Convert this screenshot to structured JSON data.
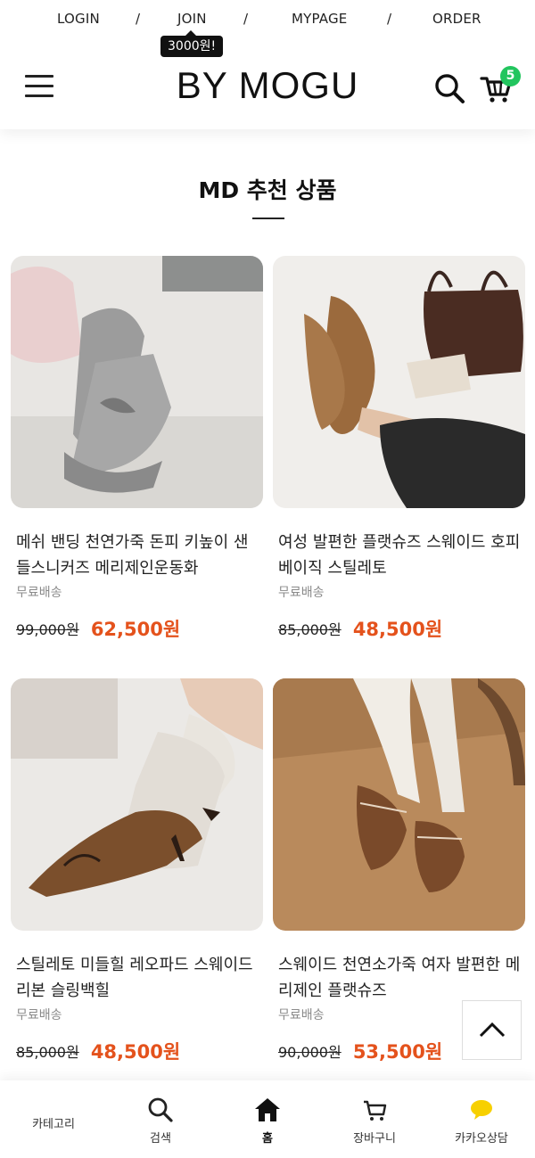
{
  "header": {
    "links": [
      "LOGIN",
      "/",
      "JOIN",
      "/",
      "MYPAGE",
      "/",
      "ORDER"
    ],
    "join_badge": "3000원!",
    "logo": "BY MOGU",
    "cart_count": "5"
  },
  "section": {
    "title": "MD 추천 상품"
  },
  "products": [
    {
      "name": "메쉬 밴딩 천연가죽 돈피 키높이 샌들스니커즈 메리제인운동화",
      "shipping": "무료배송",
      "original_price": "99,000원",
      "sale_price": "62,500원"
    },
    {
      "name": "여성 발편한 플랫슈즈 스웨이드 호피 베이직 스틸레토",
      "shipping": "무료배송",
      "original_price": "85,000원",
      "sale_price": "48,500원"
    },
    {
      "name": "스틸레토 미들힐 레오파드 스웨이드 리본 슬링백힐",
      "shipping": "무료배송",
      "original_price": "85,000원",
      "sale_price": "48,500원"
    },
    {
      "name": "스웨이드 천연소가죽 여자 발편한 메리제인 플랫슈즈",
      "shipping": "무료배송",
      "original_price": "90,000원",
      "sale_price": "53,500원"
    }
  ],
  "bottom_nav": [
    {
      "label": "카테고리",
      "icon": "category-icon"
    },
    {
      "label": "검색",
      "icon": "search-icon"
    },
    {
      "label": "홈",
      "icon": "home-icon",
      "active": true
    },
    {
      "label": "장바구니",
      "icon": "cart-icon"
    },
    {
      "label": "카카오상담",
      "icon": "kakao-chat-icon"
    }
  ],
  "colors": {
    "sale": "#e4521c",
    "badge": "#22c55e",
    "kakao": "#f7d000"
  }
}
